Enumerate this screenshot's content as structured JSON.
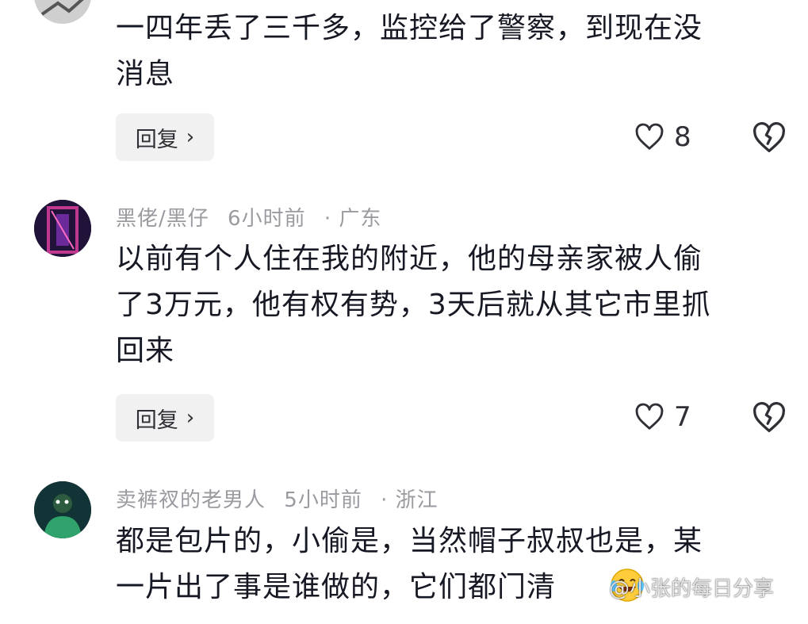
{
  "comments": [
    {
      "author": "",
      "time": "",
      "location": "",
      "text_lines": [
        "一四年丢了三千多，监控给了警察，到现在没",
        "消息"
      ],
      "reply_label": "回复",
      "likes": "8"
    },
    {
      "author": "黑佬/黑仔",
      "time": "6小时前",
      "location": "· 广东",
      "text_lines": [
        "以前有个人住在我的附近，他的母亲家被人偷",
        "了3万元，他有权有势，3天后就从其它市里抓",
        "回来"
      ],
      "reply_label": "回复",
      "likes": "7"
    },
    {
      "author": "卖裤衩的老男人",
      "time": "5小时前",
      "location": "· 浙江",
      "text_lines": [
        "都是包片的，小偷是，当然帽子叔叔也是，某",
        "一片出了事是谁做的，它们都门清"
      ]
    }
  ],
  "watermark": "@小张的每日分享",
  "icons": {
    "reply_chevron": "chevron-right-icon",
    "like": "heart-outline-icon",
    "dislike": "broken-heart-icon",
    "emoji": "laughing-tears-emoji"
  }
}
